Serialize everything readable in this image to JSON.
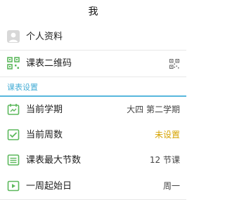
{
  "header": {
    "title": "我"
  },
  "profile": {
    "label": "个人资料",
    "icon": "avatar-icon"
  },
  "qrcode": {
    "label": "课表二维码",
    "icon": "qr-code-icon",
    "trailing_icon": "qr-code-icon"
  },
  "settings_section": {
    "title": "课表设置",
    "items": [
      {
        "label": "当前学期",
        "value": "大四 第二学期",
        "icon": "calendar-icon"
      },
      {
        "label": "当前周数",
        "value": "未设置",
        "icon": "checkbox-icon",
        "value_color": "#d6a300"
      },
      {
        "label": "课表最大节数",
        "value": "12 节课",
        "icon": "list-icon"
      },
      {
        "label": "一周起始日",
        "value": "周一",
        "icon": "week-start-icon"
      }
    ]
  },
  "colors": {
    "accent": "#47aed6",
    "icon_green": "#5cb85c",
    "warning": "#d6a300"
  }
}
